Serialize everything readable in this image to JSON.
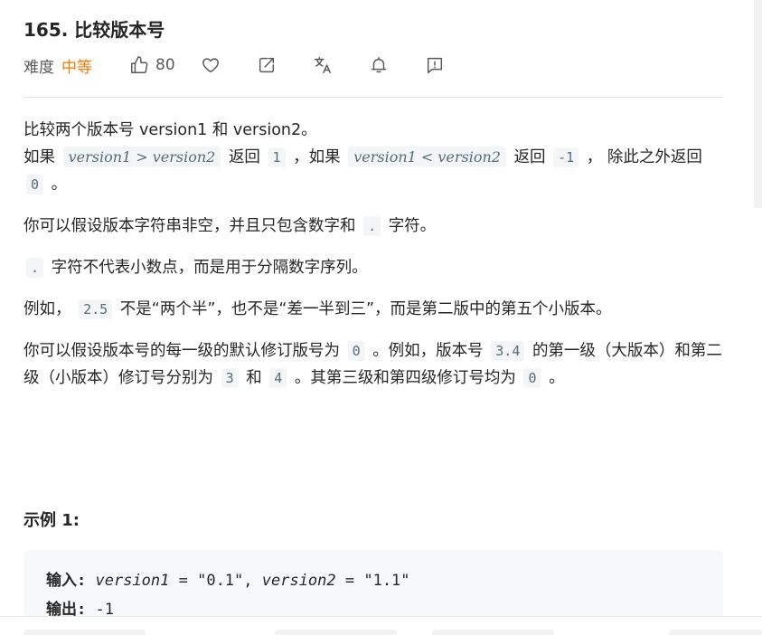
{
  "problem": {
    "title": "165. 比较版本号",
    "difficulty_label": "难度",
    "difficulty_value": "中等",
    "likes": "80"
  },
  "icons": {
    "like": "thumbs-up-icon",
    "favorite": "heart-icon",
    "share": "share-icon",
    "translate": "translate-icon",
    "notify": "bell-icon",
    "feedback": "feedback-icon"
  },
  "colors": {
    "difficulty": "#ef7a06",
    "code_bg": "#f3f5f7",
    "code_text": "#546e7a",
    "example_bg": "#f7f8fa"
  },
  "description": {
    "p1_line1": "比较两个版本号 version1 和 version2。",
    "p1_if1": "如果",
    "p1_expr1": "version1 > version2",
    "p1_return1": "返回",
    "p1_val1": "1",
    "p1_if2": "，如果",
    "p1_expr2": "version1 < version2",
    "p1_return2": "返回",
    "p1_val2": "-1",
    "p1_else": "， 除此之外返回",
    "p1_val3": "0",
    "p1_end": "。",
    "p2_text": "你可以假设版本字符串非空，并且只包含数字和",
    "p2_code": ".",
    "p2_end": "字符。",
    "p3_code": ".",
    "p3_text": "字符不代表小数点，而是用于分隔数字序列。",
    "p4_text1": "例如，",
    "p4_code": "2.5",
    "p4_text2": "不是“两个半”，也不是“差一半到三”，而是第二版中的第五个小版本。",
    "p5_text1": "你可以假设版本号的每一级的默认修订版号为",
    "p5_code1": "0",
    "p5_text2": "。例如，版本号",
    "p5_code2": "3.4",
    "p5_text3": "的第一级（大版本）和第二级（小版本）修订号分别为",
    "p5_code3": "3",
    "p5_text4": "和",
    "p5_code4": "4",
    "p5_text5": "。其第三级和第四级修订号均为",
    "p5_code5": "0",
    "p5_text6": "。"
  },
  "example": {
    "title": "示例 1:",
    "input_label": "输入:",
    "var1": "version1",
    "eq1": " = \"0.1\", ",
    "var2": "version2",
    "eq2": " = \"1.1\"",
    "output_label": "输出:",
    "output_value": " -1"
  }
}
